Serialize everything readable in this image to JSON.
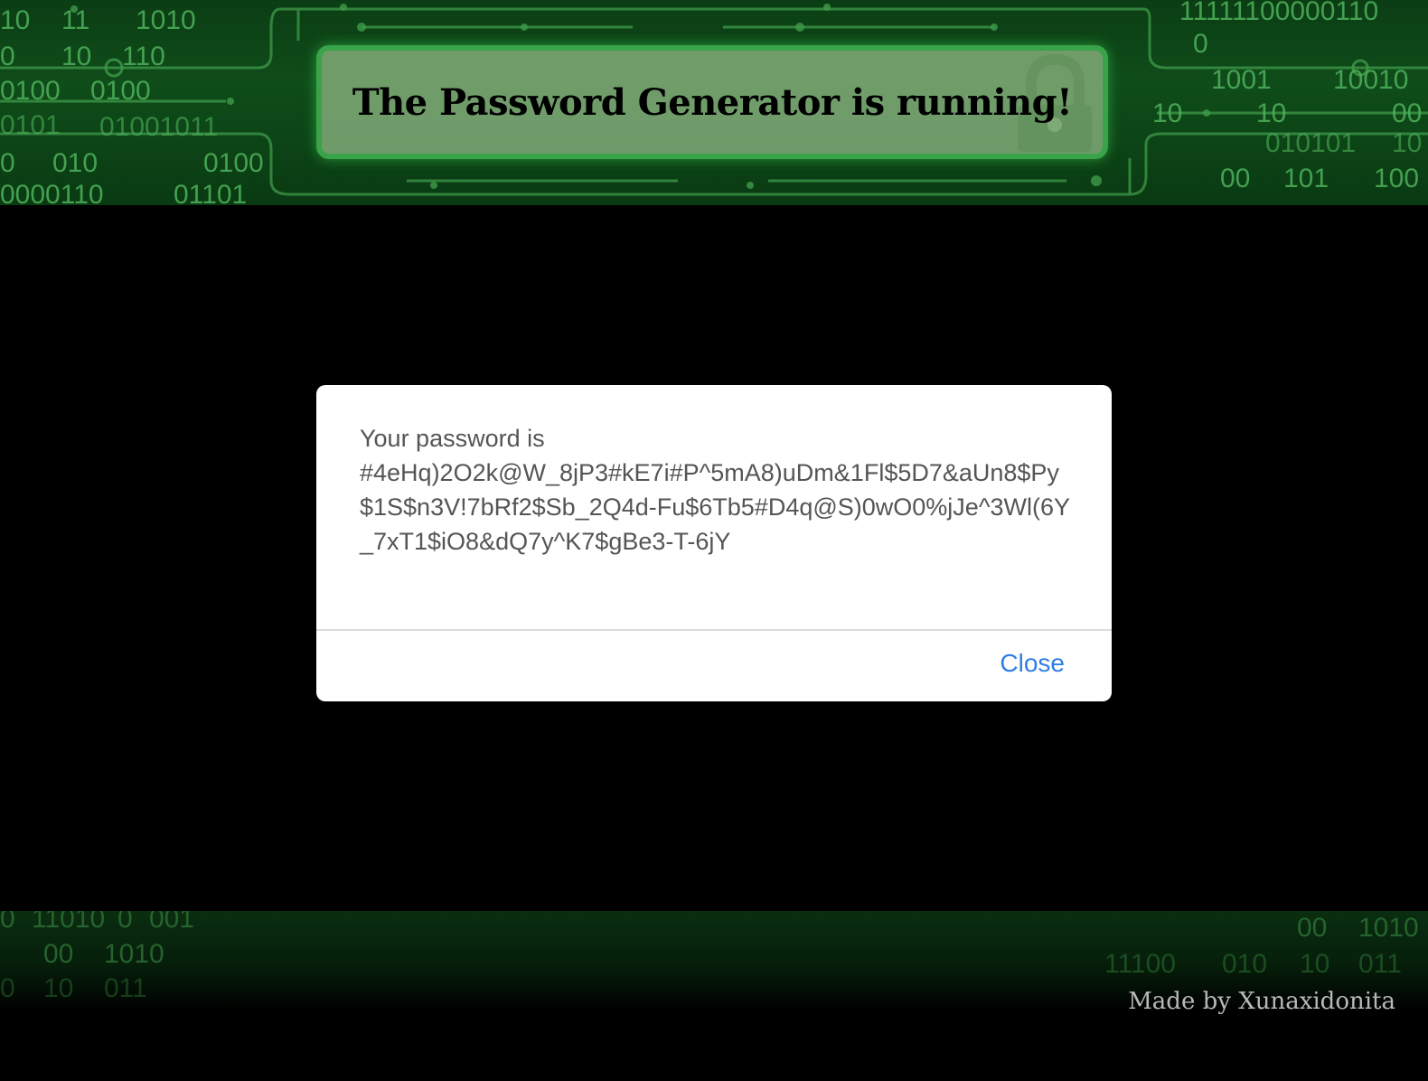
{
  "header": {
    "title": "The Password Generator is running!",
    "binary_left": [
      "10",
      "11",
      "1010",
      "0",
      "10",
      "110",
      "0100",
      "0100",
      "0101",
      "01001011",
      "0",
      "010",
      "0100",
      "0000110",
      "01101"
    ],
    "binary_right": [
      "11111100000110",
      "0",
      "1001",
      "10010",
      "10",
      "10",
      "00",
      "010101",
      "10",
      "00",
      "101",
      "100"
    ],
    "lock_icon": "padlock-icon",
    "accent_color": "#39a34a",
    "background_color": "#0f4d1a"
  },
  "modal": {
    "message_label": "Your password is",
    "password": "#4eHq)2O2k@W_8jP3#kE7i#P^5mA8)uDm&1Fl$5D7&aUn8$Py$1S$n3V!7bRf2$Sb_2Q4d-Fu$6Tb5#D4q@S)0wO0%jJe^3Wl(6Y_7xT1$iO8&dQ7y^K7$gBe3-T-6jY",
    "close_label": "Close",
    "close_color": "#2f7ee6"
  },
  "footer": {
    "credit": "Made by Xunaxidonita",
    "binary_left": [
      "0",
      "11010",
      "0",
      "001",
      "00",
      "1010",
      "0",
      "10",
      "011"
    ],
    "binary_right": [
      "00",
      "1010",
      "11100",
      "010",
      "10",
      "011"
    ]
  }
}
